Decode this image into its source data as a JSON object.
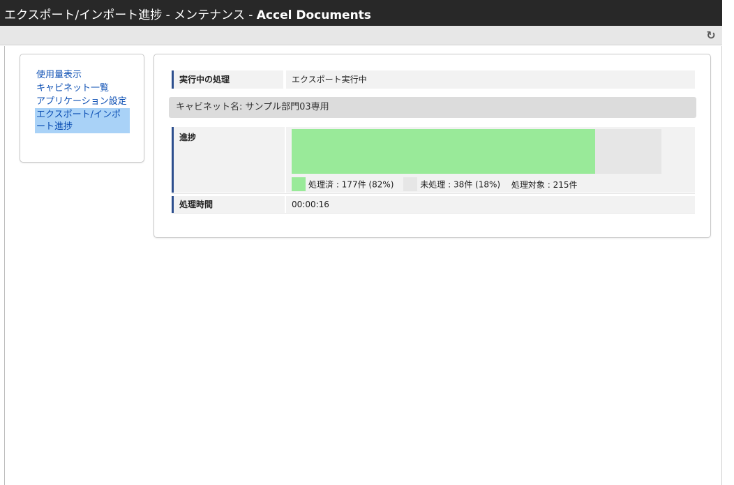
{
  "window": {
    "title_prefix": "エクスポート/インポート進捗 - メンテナンス - ",
    "title_brand": "Accel Documents"
  },
  "toolbar": {
    "refresh_icon": "refresh-icon",
    "refresh_glyph": "↻"
  },
  "sidebar": {
    "items": [
      {
        "label": "使用量表示",
        "active": false
      },
      {
        "label": "キャビネット一覧",
        "active": false
      },
      {
        "label": "アプリケーション設定",
        "active": false
      },
      {
        "label": "エクスポート/インポート進捗",
        "active": true
      }
    ]
  },
  "status": {
    "label": "実行中の処理",
    "value": "エクスポート実行中"
  },
  "cabinet": {
    "text": "キャビネット名: サンプル部門03専用"
  },
  "progress": {
    "label": "進捗",
    "fraction_done": 0.82,
    "done_text": "処理済 : 177件 (82%)",
    "pending_text": "未処理 : 38件 (18%)",
    "total_text": "処理対象 : 215件",
    "colors": {
      "done": "#99ea99",
      "pending": "#e6e6e6"
    }
  },
  "elapsed": {
    "label": "処理時間",
    "value": "00:00:16"
  },
  "colors": {
    "titlebar": "#282828",
    "accent_border": "#2d4f8e",
    "link": "#0b4eb3",
    "active_item_bg": "#a9d2f7"
  }
}
